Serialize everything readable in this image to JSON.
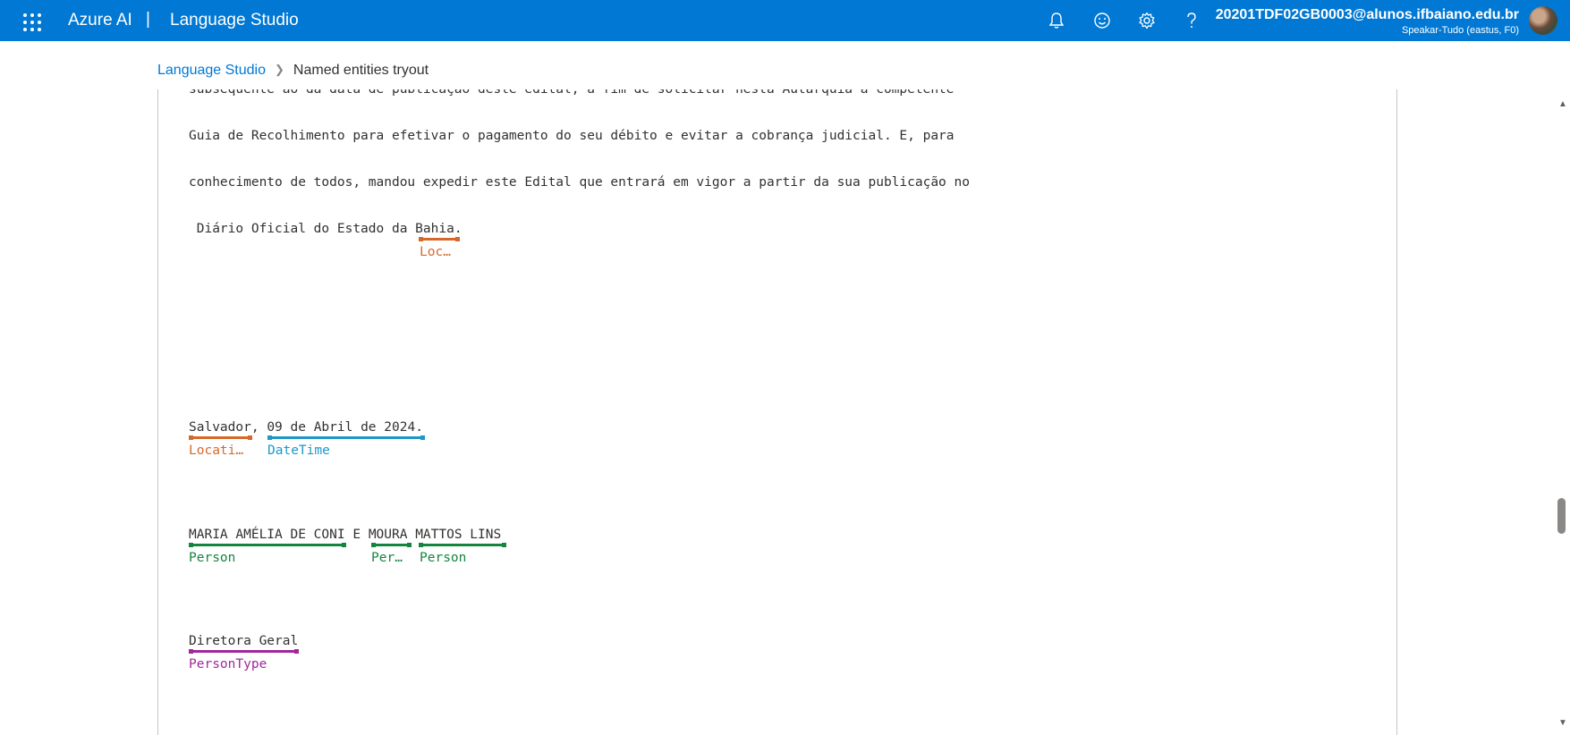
{
  "header": {
    "brand": "Azure AI",
    "separator": "|",
    "product": "Language Studio",
    "account_email": "20201TDF02GB0003@alunos.ifbaiano.edu.br",
    "account_resource": "Speakar-Tudo (eastus, F0)",
    "icons": [
      "waffle-icon",
      "bell-icon",
      "smiley-icon",
      "gear-icon",
      "help-icon"
    ]
  },
  "breadcrumb": {
    "root": "Language Studio",
    "current": "Named entities tryout"
  },
  "document": {
    "lines": [
      "subsequente ao da data de publicação deste edital, a fim de solicitar nesta Autarquia a competente",
      "Guia de Recolhimento para efetivar o pagamento do seu débito e evitar a cobrança judicial. E, para",
      "conhecimento de todos, mandou expedir este Edital que entrará em vigor a partir da sua publicação no"
    ],
    "line4_pre": " Diário Oficial do Estado da ",
    "line4_entity": "Bahia",
    "line4_post": ".",
    "line5_e1": "Salvador",
    "line5_sep": ", ",
    "line5_e2": "09 de Abril de 2024",
    "line5_post": ".",
    "line6_e1": "MARIA AMÉLIA DE CONI",
    "line6_sep": " E ",
    "line6_e2": "MOURA",
    "line6_e3": "MATTOS LINS",
    "line7_e1": "Diretora Geral"
  },
  "entity_labels": {
    "bahia": "Loc…",
    "salvador": "Locati…",
    "date": "DateTime",
    "maria": "Person",
    "moura": "Per…",
    "mattos": "Person",
    "diretora": "PersonType"
  },
  "entity_colors": {
    "Location": "#d6692a",
    "DateTime": "#1f97c8",
    "Person": "#14853d",
    "PersonType": "#a3269a"
  }
}
